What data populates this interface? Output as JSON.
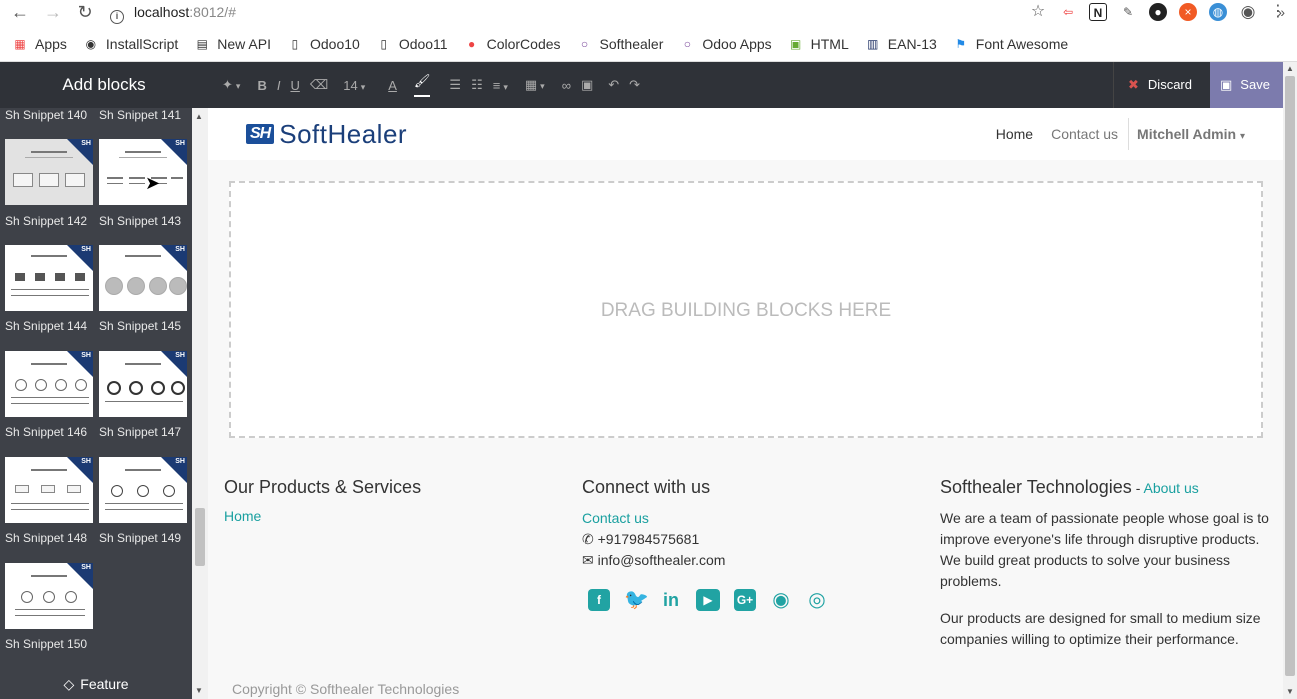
{
  "browser": {
    "url_host": "localhost",
    "url_rest": ":8012/#",
    "bookmarks": [
      "Apps",
      "InstallScript",
      "New API",
      "Odoo10",
      "Odoo11",
      "ColorCodes",
      "Softhealer",
      "Odoo Apps",
      "HTML",
      "EAN-13",
      "Font Awesome"
    ]
  },
  "sidebar": {
    "title": "Add blocks",
    "snippets": [
      "Sh Snippet 140",
      "Sh Snippet 141",
      "Sh Snippet 142",
      "Sh Snippet 143",
      "Sh Snippet 144",
      "Sh Snippet 145",
      "Sh Snippet 146",
      "Sh Snippet 147",
      "Sh Snippet 148",
      "Sh Snippet 149",
      "Sh Snippet 150"
    ],
    "feature_label": "Feature",
    "badge_text": "SH"
  },
  "toolbar": {
    "font_size": "14",
    "discard_label": "Discard",
    "save_label": "Save"
  },
  "site": {
    "logo_mark": "SH",
    "logo_name": "SoftHealer",
    "nav": [
      "Home",
      "Contact us"
    ],
    "user": "Mitchell Admin",
    "drop_message": "DRAG BUILDING BLOCKS HERE",
    "footer": {
      "col1_title": "Our Products & Services",
      "col1_link": "Home",
      "col2_title": "Connect with us",
      "col2_link": "Contact us",
      "phone": "+917984575681",
      "email": "info@softhealer.com",
      "col3_title": "Softhealer Technologies",
      "col3_title_sep": " - ",
      "col3_link": "About us",
      "para1": "We are a team of passionate people whose goal is to improve everyone's life through disruptive products. We build great products to solve your business problems.",
      "para2": "Our products are designed for small to medium size companies willing to optimize their performance."
    },
    "copyright": "Copyright © Softhealer Technologies"
  },
  "colors": {
    "accent": "#21a3a3",
    "save_bg": "#7c7bad",
    "sidebar_bg": "#3e4148"
  },
  "icons": [
    "back-icon",
    "forward-icon",
    "reload-icon",
    "info-icon",
    "star-icon",
    "account-icon",
    "menu-icon"
  ]
}
